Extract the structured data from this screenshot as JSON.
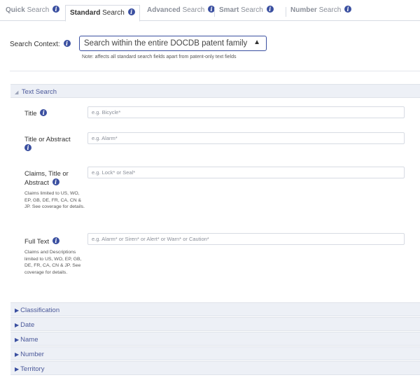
{
  "tabs": [
    {
      "bold": "Quick",
      "rest": " Search"
    },
    {
      "bold": "Standard",
      "rest": " Search"
    },
    {
      "bold": "Advanced",
      "rest": " Search"
    },
    {
      "bold": "Smart",
      "rest": " Search"
    },
    {
      "bold": "Number",
      "rest": " Search"
    }
  ],
  "active_tab": "Standard Search",
  "context": {
    "label": "Search Context:",
    "selected": "Search within the entire DOCDB patent family",
    "note": "Note: affects all standard search fields apart from patent-only text fields"
  },
  "text_search": {
    "header": "Text Search",
    "fields": [
      {
        "label": "Title",
        "placeholder": "e.g. Bicycle*",
        "sub": ""
      },
      {
        "label": "Title or Abstract",
        "placeholder": "e.g. Alarm*",
        "sub": ""
      },
      {
        "label": "Claims, Title or Abstract",
        "placeholder": "e.g. Lock* or Seal*",
        "sub": "Claims limited to US, WO, EP, GB, DE, FR, CA, CN & JP. See coverage for details."
      },
      {
        "label": "Full Text",
        "placeholder": "e.g. Alarm* or Siren* or Alert* or Warn* or Caution*",
        "sub": "Claims and Descriptions limited to US, WO, EP, GB, DE, FR, CA, CN & JP. See coverage for details."
      }
    ]
  },
  "collapsed_panels": [
    "Classification",
    "Date",
    "Name",
    "Number",
    "Territory"
  ],
  "colors": {
    "accent": "#3a4fa0",
    "panel_bg": "#edf0f6"
  },
  "icons": {
    "info": "info-circle-icon",
    "collapsed": "triangle-right-icon",
    "expanded": "triangle-down-icon"
  }
}
